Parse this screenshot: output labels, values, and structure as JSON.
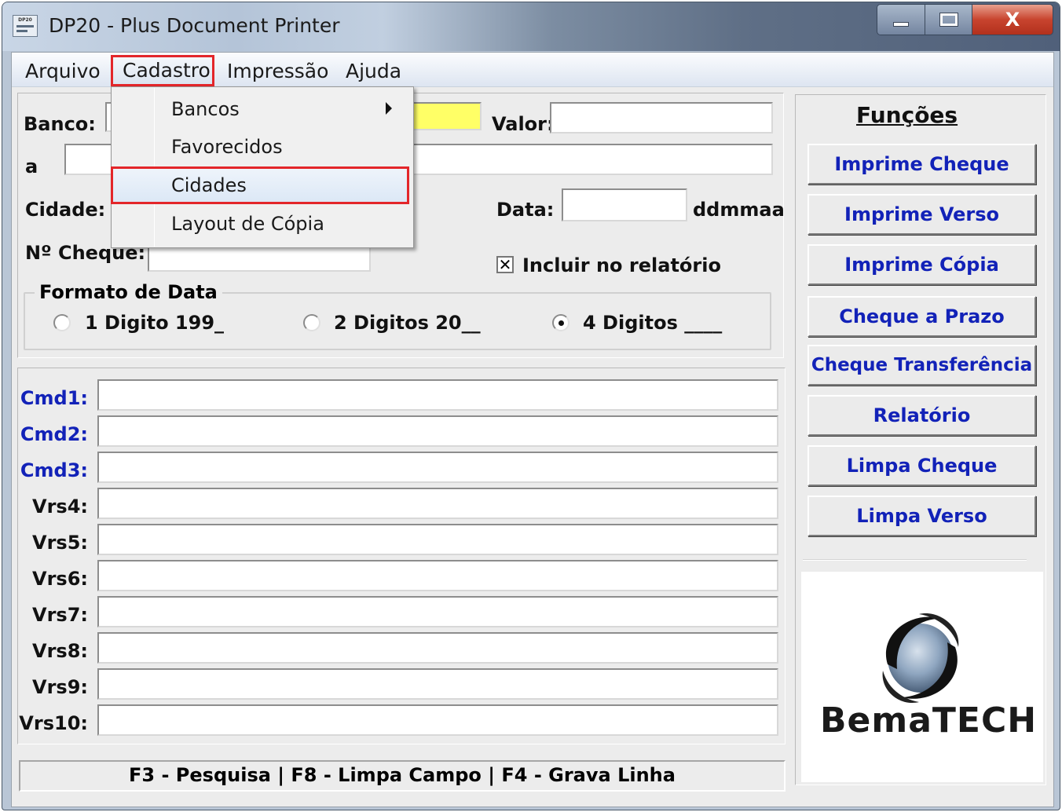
{
  "window": {
    "title": "DP20 - Plus Document Printer",
    "icon_label": "DP20",
    "close_glyph": "X"
  },
  "menubar": {
    "items": [
      {
        "label": "Arquivo"
      },
      {
        "label": "Cadastro"
      },
      {
        "label": "Impressão"
      },
      {
        "label": "Ajuda"
      }
    ]
  },
  "dropdown": {
    "items": [
      {
        "label": "Bancos",
        "has_submenu": true
      },
      {
        "label": "Favorecidos"
      },
      {
        "label": "Cidades",
        "highlighted": true
      },
      {
        "label": "Layout de Cópia"
      }
    ]
  },
  "form": {
    "banco_label": "Banco:",
    "valor_label": "Valor:",
    "a_label": "a",
    "cidade_label": "Cidade:",
    "data_label": "Data:",
    "data_hint": "ddmmaa",
    "cheque_label": "Nº Cheque:",
    "incluir_label": "Incluir no relatório",
    "incluir_checked": true
  },
  "formato": {
    "legend": "Formato de Data",
    "options": [
      {
        "label": "1 Digito 199_",
        "selected": false
      },
      {
        "label": "2 Digitos 20__",
        "selected": false
      },
      {
        "label": "4 Digitos ____",
        "selected": true
      }
    ]
  },
  "commands": [
    {
      "label": "Cmd1:",
      "style": "blue"
    },
    {
      "label": "Cmd2:",
      "style": "blue"
    },
    {
      "label": "Cmd3:",
      "style": "blue"
    },
    {
      "label": "Vrs4:",
      "style": "black"
    },
    {
      "label": "Vrs5:",
      "style": "black"
    },
    {
      "label": "Vrs6:",
      "style": "black"
    },
    {
      "label": "Vrs7:",
      "style": "black"
    },
    {
      "label": "Vrs8:",
      "style": "black"
    },
    {
      "label": "Vrs9:",
      "style": "black"
    },
    {
      "label": "Vrs10:",
      "style": "black"
    }
  ],
  "funcoes": {
    "title": "Funções",
    "buttons": [
      {
        "label": "Imprime Cheque"
      },
      {
        "label": "Imprime Verso"
      },
      {
        "label": "Imprime Cópia"
      },
      {
        "label": "Cheque a Prazo"
      },
      {
        "label": "Cheque Transferência"
      },
      {
        "label": "Relatório"
      },
      {
        "label": "Limpa Cheque"
      },
      {
        "label": "Limpa Verso"
      }
    ]
  },
  "logo": {
    "text": "BemaTECH"
  },
  "statusbar": {
    "text": "F3 - Pesquisa  |  F8 - Limpa Campo  |  F4 - Grava Linha"
  },
  "colors": {
    "accent_blue": "#1222b8",
    "highlight_red": "#e3262a",
    "field_yellow": "#ffff66"
  }
}
